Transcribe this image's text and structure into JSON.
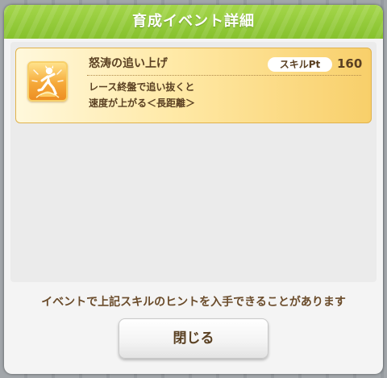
{
  "dialog": {
    "title": "育成イベント詳細",
    "header_color": "#8cc63f"
  },
  "skill": {
    "name": "怒涛の追い上げ",
    "pt_label": "スキルPt",
    "pt_value": "160",
    "description": [
      "レース終盤で追い抜くと",
      "速度が上がる＜長距離＞"
    ],
    "icon": "running-speed-up-icon"
  },
  "hint": "イベントで上記スキルのヒントを入手できることがあります",
  "buttons": {
    "close_label": "閉じる"
  }
}
